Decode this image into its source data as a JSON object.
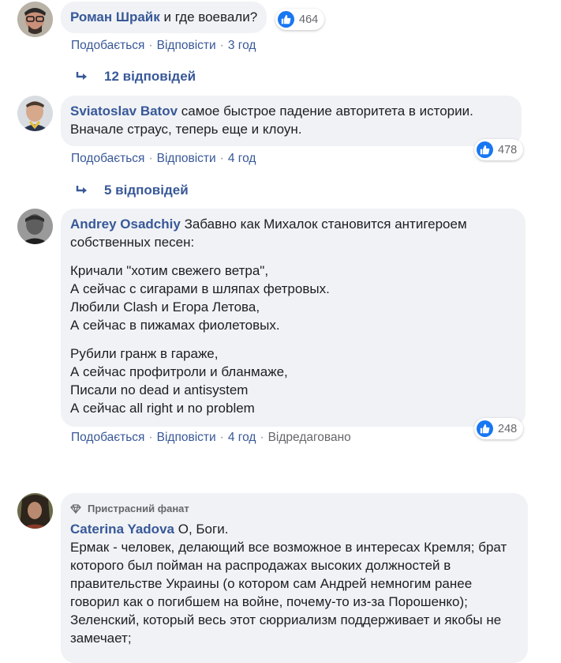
{
  "comments": [
    {
      "author": "Роман Шрайк",
      "paragraphs": [
        "и где воевали?"
      ],
      "likes": "464",
      "actions": {
        "like": "Подобається",
        "reply": "Відповісти",
        "time": "3 год"
      },
      "replies_label": "12 відповідей"
    },
    {
      "author": "Sviatoslav Batov",
      "paragraphs": [
        "самое быстрое падение авторитета в истории. Вначале страус, теперь еще и клоун."
      ],
      "likes": "478",
      "actions": {
        "like": "Подобається",
        "reply": "Відповісти",
        "time": "4 год"
      },
      "replies_label": "5 відповідей"
    },
    {
      "author": "Andrey Osadchiy",
      "paragraphs": [
        "Забавно как Михалок становится антигероем собственных песен:",
        "Кричали \"хотим свежего ветра\",\nА сейчас с сигарами в шляпах фетровых.\nЛюбили Clash и Егора Летова,\nА сейчас в пижамах фиолетовых.",
        "Рубили гранж в гараже,\nА сейчас профитроли и бланмаже,\nПисали no dead и antisystem\nА сейчас all right и no problem"
      ],
      "likes": "248",
      "actions": {
        "like": "Подобається",
        "reply": "Відповісти",
        "time": "4 год",
        "edited": "Відредаговано"
      }
    },
    {
      "badge": "Пристрасний фанат",
      "author": "Caterina Yadova",
      "paragraphs": [
        "О, Боги.\nЕрмак - человек, делающий все возможное в интересах Кремля; брат которого был пойман на распродажах высоких должностей в правительстве Украины (о котором сам Андрей немногим ранее говорил как о погибшем на войне, почему-то из-за Порошенко); Зеленский, который весь этот сюрриализм поддерживает и якобы не замечает;"
      ]
    }
  ],
  "icons": {
    "like": "thumbs-up-icon",
    "reply_arrow": "reply-arrow-icon",
    "badge": "diamond-icon"
  },
  "colors": {
    "link": "#385898",
    "like_blue": "#1877f2",
    "bubble": "#f0f2f5"
  }
}
